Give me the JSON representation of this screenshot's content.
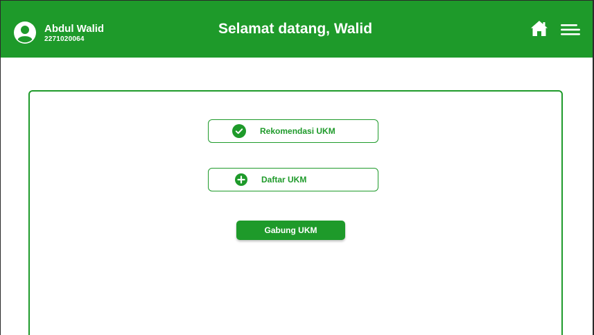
{
  "header": {
    "user_name": "Abdul Walid",
    "user_id": "2271020064",
    "welcome_text": "Selamat datang, Walid",
    "icons": [
      "user-avatar-icon",
      "home-icon",
      "menu-icon"
    ]
  },
  "main": {
    "options": [
      {
        "label": "Rekomendasi UKM",
        "icon": "check-circle-icon"
      },
      {
        "label": "Daftar UKM",
        "icon": "plus-circle-icon"
      }
    ],
    "join_label": "Gabung UKM"
  },
  "colors": {
    "brand_green": "#1e9a2a",
    "background": "#ffffff",
    "text_on_brand": "#ffffff"
  }
}
